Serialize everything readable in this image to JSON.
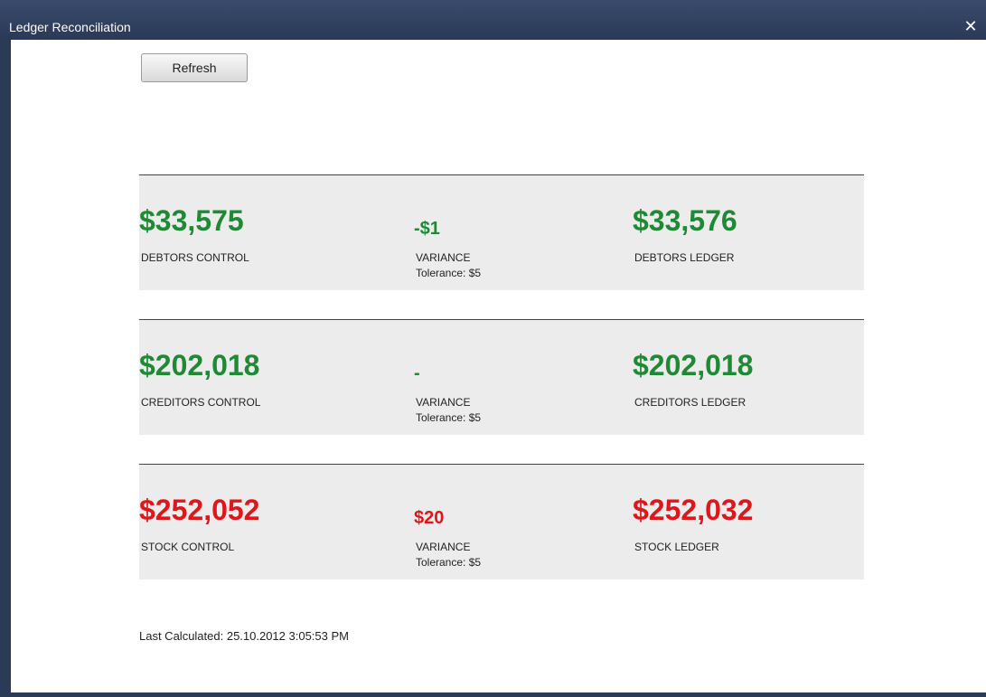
{
  "window": {
    "title": "Ledger Reconciliation",
    "close_glyph": "✕"
  },
  "toolbar": {
    "refresh_label": "Refresh"
  },
  "colors": {
    "ok": "#1e8a34",
    "error": "#e0161b"
  },
  "rows": [
    {
      "status": "ok",
      "control_value": "$33,575",
      "control_label": "DEBTORS CONTROL",
      "variance_value": "-$1",
      "variance_label": "VARIANCE",
      "tolerance": "Tolerance: $5",
      "ledger_value": "$33,576",
      "ledger_label": "DEBTORS LEDGER"
    },
    {
      "status": "ok",
      "control_value": "$202,018",
      "control_label": "CREDITORS CONTROL",
      "variance_value": "-",
      "variance_label": "VARIANCE",
      "tolerance": "Tolerance: $5",
      "ledger_value": "$202,018",
      "ledger_label": "CREDITORS LEDGER"
    },
    {
      "status": "error",
      "control_value": "$252,052",
      "control_label": "STOCK CONTROL",
      "variance_value": "$20",
      "variance_label": "VARIANCE",
      "tolerance": "Tolerance: $5",
      "ledger_value": "$252,032",
      "ledger_label": "STOCK LEDGER"
    }
  ],
  "footer": {
    "last_calculated": "Last Calculated: 25.10.2012 3:05:53 PM"
  }
}
